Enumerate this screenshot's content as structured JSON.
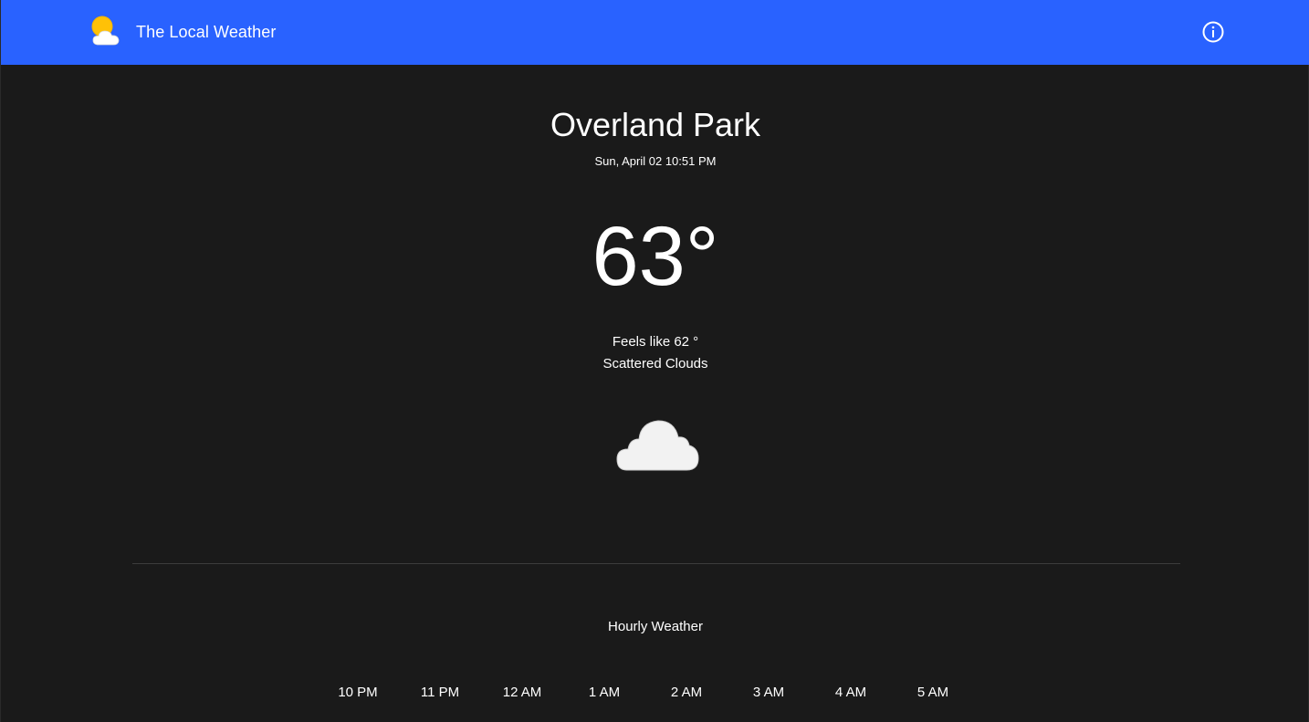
{
  "header": {
    "title": "The Local Weather",
    "logo_icon": "sun-behind-cloud-icon",
    "info_icon": "info-circle-icon",
    "bar_color": "#2962ff"
  },
  "current": {
    "city": "Overland Park",
    "datetime": "Sun, April 02 10:51 PM",
    "temperature": "63°",
    "feels_like": "Feels like 62 °",
    "condition": "Scattered Clouds",
    "condition_icon": "cloud-icon"
  },
  "hourly": {
    "heading": "Hourly Weather",
    "hours": [
      {
        "time": "10 PM"
      },
      {
        "time": "11 PM"
      },
      {
        "time": "12 AM"
      },
      {
        "time": "1 AM"
      },
      {
        "time": "2 AM"
      },
      {
        "time": "3 AM"
      },
      {
        "time": "4 AM"
      },
      {
        "time": "5 AM"
      }
    ]
  },
  "colors": {
    "background": "#1a1a1a",
    "accent": "#2962ff",
    "sun": "#ffc107",
    "cloud": "#f2f2f2"
  }
}
